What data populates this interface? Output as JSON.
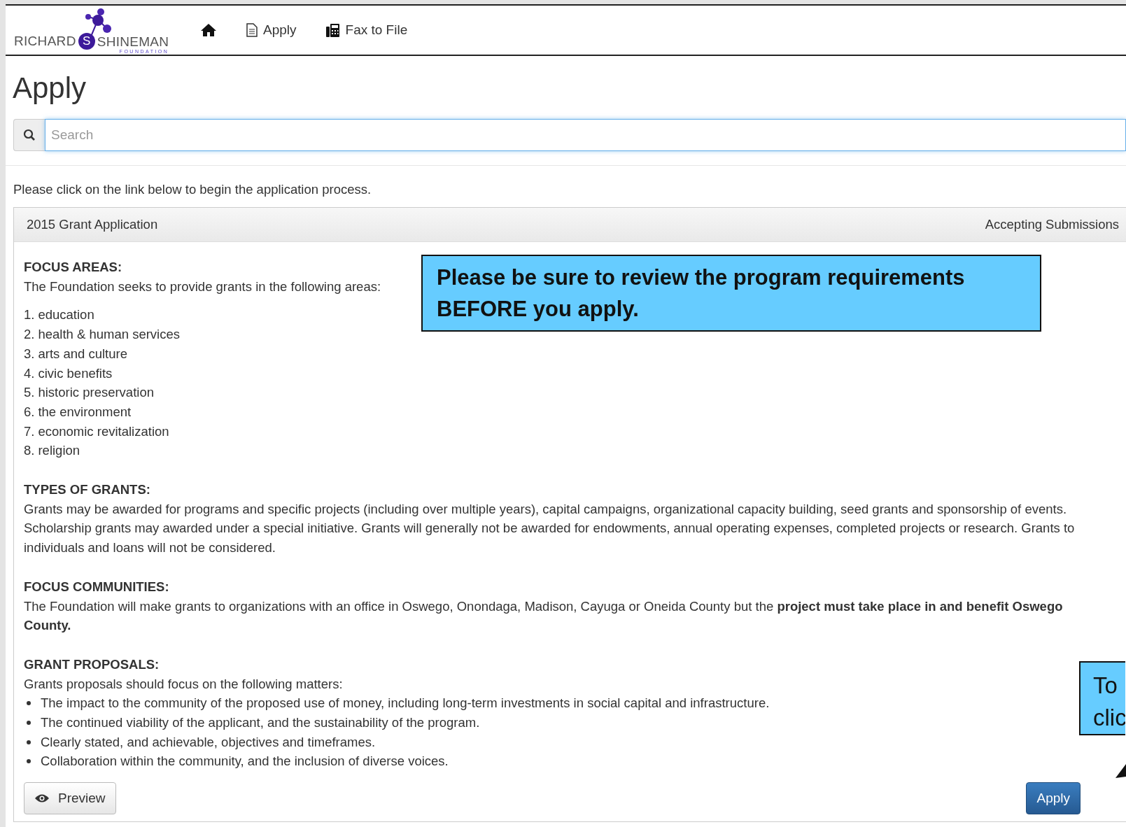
{
  "brand": {
    "name_left": "RICHARD",
    "initial": "S",
    "name_right": "SHINEMAN",
    "tagline": "FOUNDATION"
  },
  "nav": [
    {
      "kind": "home"
    },
    {
      "kind": "document",
      "label": "Apply"
    },
    {
      "kind": "fax",
      "label": "Fax to File"
    }
  ],
  "heading": "Apply",
  "search": {
    "placeholder": "Search"
  },
  "intro": "Please click on the link below to begin the application process.",
  "panel": {
    "title": "2015 Grant Application",
    "status": "Accepting Submissions",
    "sections": [
      {
        "kind": "numbered",
        "heading": "FOCUS AREAS:",
        "text": "The Foundation seeks to provide grants in the following areas:",
        "items": [
          {
            "number": "1.",
            "text": "education"
          },
          {
            "number": "2.",
            "text": "health & human services"
          },
          {
            "number": "3.",
            "text": "arts and culture"
          },
          {
            "number": "4.",
            "text": "civic benefits"
          },
          {
            "number": "5.",
            "text": "historic preservation"
          },
          {
            "number": "6.",
            "text": "the environment"
          },
          {
            "number": "7.",
            "text": "economic revitalization"
          },
          {
            "number": "8.",
            "text": "religion"
          }
        ]
      },
      {
        "kind": "paragraph",
        "heading": "TYPES OF GRANTS:",
        "text": "Grants may be awarded for programs and specific projects (including over multiple years), capital campaigns, organizational capacity building, seed grants and sponsorship of events. Scholarship grants may awarded under a special initiative. Grants will generally not be awarded for endowments, annual operating expenses, completed projects or research. Grants to individuals and loans will not be considered."
      },
      {
        "kind": "paragraph",
        "heading": "FOCUS COMMUNITIES:",
        "text": "The Foundation will make grants to organizations with an office in Oswego, Onondaga, Madison, Cayuga or Oneida County but the **project must take place in and benefit Oswego County.**"
      },
      {
        "kind": "bulleted",
        "heading": "GRANT PROPOSALS:",
        "text": "Grants proposals should focus on the following matters:",
        "items": [
          "The impact to the community of the proposed use of money, including long-term investments in social capital and infrastructure.",
          "The continued viability of the applicant, and the sustainability of the program.",
          "Clearly stated, and achievable, objectives and timeframes.",
          "Collaboration within the community, and the inclusion of diverse voices."
        ]
      }
    ],
    "preview_button": "Preview",
    "apply_button": "Apply"
  },
  "callouts": [
    {
      "kind": "main",
      "text": "Please be sure to review the program requirements BEFORE you apply."
    },
    {
      "kind": "edge",
      "lines": [
        "To",
        "clic"
      ]
    }
  ]
}
